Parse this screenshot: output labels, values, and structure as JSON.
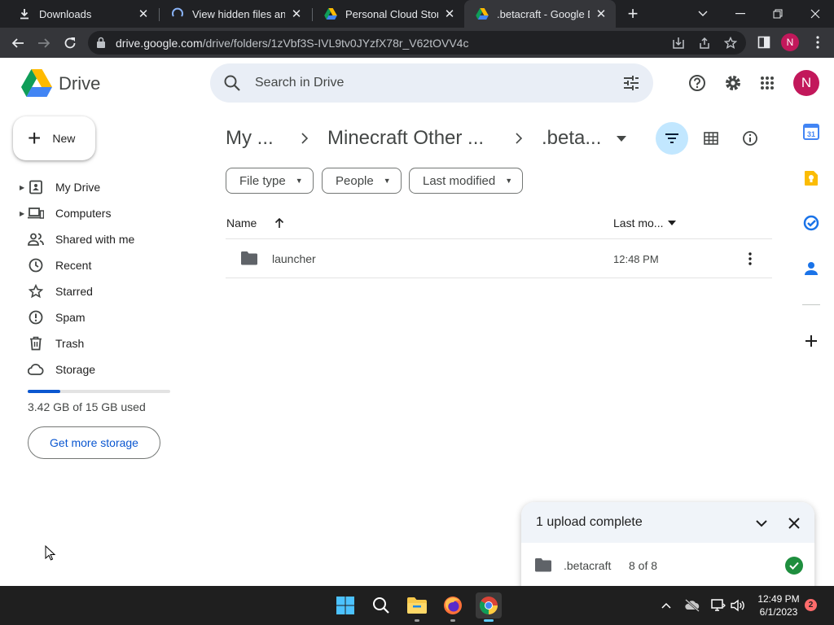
{
  "browser": {
    "tabs": [
      {
        "title": "Downloads",
        "icon": "download-icon",
        "active": false
      },
      {
        "title": "View hidden files and fo",
        "icon": "loading-spinner-icon",
        "active": false
      },
      {
        "title": "Personal Cloud Storage",
        "icon": "google-drive-icon",
        "active": false
      },
      {
        "title": ".betacraft - Google Driv",
        "icon": "google-drive-icon",
        "active": true
      }
    ],
    "new_tab": "+",
    "url_host": "drive.google.com",
    "url_path": "/drive/folders/1zVbf3S-IVL9tv0JYzfX78r_V62tOVV4c",
    "profile_initial": "N"
  },
  "drive": {
    "brand": "Drive",
    "search_placeholder": "Search in Drive",
    "avatar_initial": "N",
    "new_label": "New",
    "nav": [
      {
        "label": "My Drive",
        "icon": "my-drive-icon",
        "expandable": true
      },
      {
        "label": "Computers",
        "icon": "computers-icon",
        "expandable": true
      },
      {
        "label": "Shared with me",
        "icon": "shared-people-icon",
        "expandable": false
      },
      {
        "label": "Recent",
        "icon": "clock-icon",
        "expandable": false
      },
      {
        "label": "Starred",
        "icon": "star-icon",
        "expandable": false
      },
      {
        "label": "Spam",
        "icon": "spam-icon",
        "expandable": false
      },
      {
        "label": "Trash",
        "icon": "trash-icon",
        "expandable": false
      },
      {
        "label": "Storage",
        "icon": "cloud-icon",
        "expandable": false
      }
    ],
    "storage": {
      "used_text": "3.42 GB of 15 GB used",
      "fraction_used": 0.228
    },
    "get_storage_label": "Get more storage",
    "breadcrumb": [
      "My ...",
      "Minecraft Other ...",
      ".beta..."
    ],
    "filters": [
      "File type",
      "People",
      "Last modified"
    ],
    "columns": {
      "name": "Name",
      "modified": "Last mo..."
    },
    "files": [
      {
        "name": "launcher",
        "modified": "12:48 PM",
        "type": "folder"
      }
    ],
    "upload": {
      "title": "1 upload complete",
      "item_name": ".betacraft",
      "item_count": "8 of 8"
    }
  },
  "taskbar": {
    "time": "12:49 PM",
    "date": "6/1/2023",
    "notifications": "2"
  },
  "colors": {
    "accent_blue": "#0b57d0",
    "selected_view": "#c2e7ff",
    "avatar": "#c2185b",
    "success_green": "#1e8e3e"
  }
}
